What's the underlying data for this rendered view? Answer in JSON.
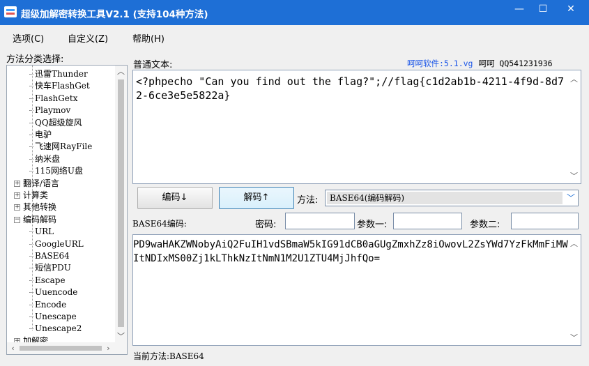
{
  "window": {
    "title": "超级加解密转换工具V2.1 (支持104种方法)",
    "min": "—",
    "max": "☐",
    "close": "✕"
  },
  "menu": [
    "选项(C)",
    "自定义(Z)",
    "帮助(H)"
  ],
  "tree": {
    "label": "方法分类选择:",
    "items": [
      {
        "text": "迅雷Thunder",
        "kind": "leaf"
      },
      {
        "text": "快车FlashGet",
        "kind": "leaf"
      },
      {
        "text": "FlashGetx",
        "kind": "leaf"
      },
      {
        "text": "Playmov",
        "kind": "leaf"
      },
      {
        "text": "QQ超级旋风",
        "kind": "leaf"
      },
      {
        "text": "电驴",
        "kind": "leaf"
      },
      {
        "text": "飞速网RayFile",
        "kind": "leaf"
      },
      {
        "text": "纳米盘",
        "kind": "leaf"
      },
      {
        "text": "115网络U盘",
        "kind": "leaf"
      },
      {
        "text": "翻译/语言",
        "kind": "parent",
        "expander": "+"
      },
      {
        "text": "计算类",
        "kind": "parent",
        "expander": "+"
      },
      {
        "text": "其他转换",
        "kind": "parent",
        "expander": "+"
      },
      {
        "text": "编码解码",
        "kind": "parent",
        "expander": "−"
      },
      {
        "text": "URL",
        "kind": "leaf"
      },
      {
        "text": "GoogleURL",
        "kind": "leaf"
      },
      {
        "text": "BASE64",
        "kind": "leaf"
      },
      {
        "text": "短信PDU",
        "kind": "leaf"
      },
      {
        "text": "Escape",
        "kind": "leaf"
      },
      {
        "text": "Uuencode",
        "kind": "leaf"
      },
      {
        "text": "Encode",
        "kind": "leaf"
      },
      {
        "text": "Unescape",
        "kind": "leaf"
      },
      {
        "text": "Unescape2",
        "kind": "leaf"
      },
      {
        "text": "加解密",
        "kind": "parent",
        "expander": "+"
      }
    ]
  },
  "plain": {
    "label": "普通文本:",
    "credit_link": "呵呵软件:5.1.vg",
    "credit_rest": "呵呵 QQ541231936",
    "text": "<?phpecho \"Can you find out the flag?\";//flag{c1d2ab1b-4211-4f9d-8d72-6ce3e5e5822a}"
  },
  "buttons": {
    "encode": "编码↓",
    "decode": "解码↑"
  },
  "method": {
    "label": "方法:",
    "value": "BASE64(编码解码)"
  },
  "encoded": {
    "label": "BASE64编码:",
    "password_label": "密码:",
    "param1_label": "参数一:",
    "param2_label": "参数二:",
    "password": "",
    "param1": "",
    "param2": "",
    "text": "PD9waHAKZWNobyAiQ2FuIH1vdSBmaW5kIG91dCB0aGUgZmxhZz8iOwovL2ZsYWd7YzFkMmFiMWItNDIxMS00Zj1kLThkNzItNmN1M2U1ZTU4MjJhfQo="
  },
  "status": "当前方法:BASE64"
}
